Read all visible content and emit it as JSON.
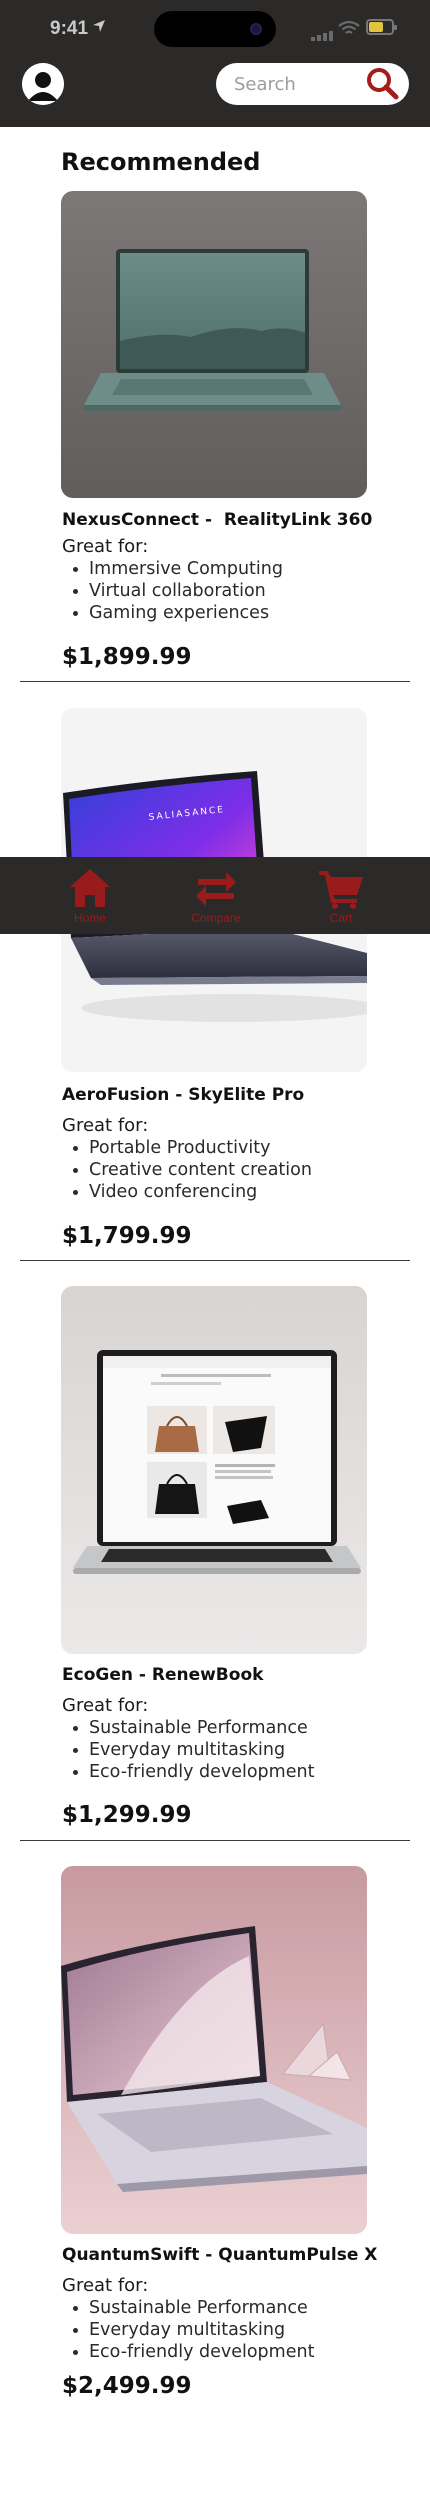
{
  "status_bar": {
    "time": "9:41"
  },
  "header": {
    "search": {
      "placeholder": "Search",
      "value": ""
    }
  },
  "section_title": "Recommended",
  "products": [
    {
      "name": "NexusConnect -  RealityLink 360",
      "great_for_label": "Great for:",
      "features": [
        "Immersive Computing",
        "Virtual collaboration",
        "Gaming experiences"
      ],
      "price": "$1,899.99"
    },
    {
      "name": "AeroFusion - SkyElite Pro",
      "great_for_label": "Great for:",
      "features": [
        "Portable Productivity",
        "Creative content creation",
        "Video conferencing"
      ],
      "price": "$1,799.99",
      "screen_text": "SALIASANCE"
    },
    {
      "name": "EcoGen - RenewBook",
      "great_for_label": "Great for:",
      "features": [
        "Sustainable Performance",
        "Everyday multitasking",
        "Eco-friendly development"
      ],
      "price": "$1,299.99"
    },
    {
      "name": "QuantumSwift - QuantumPulse X",
      "great_for_label": "Great for:",
      "features": [
        "Sustainable Performance",
        "Everyday multitasking",
        "Eco-friendly development"
      ],
      "price": "$2,499.99"
    }
  ],
  "bottom_nav": {
    "items": [
      {
        "label": "Home",
        "icon": "home-icon"
      },
      {
        "label": "Compare",
        "icon": "compare-arrows-icon"
      },
      {
        "label": "Cart",
        "icon": "cart-icon"
      }
    ]
  },
  "colors": {
    "header_bg": "#2b2a29",
    "accent_red": "#9a1b1b",
    "search_icon": "#a51c1c"
  }
}
